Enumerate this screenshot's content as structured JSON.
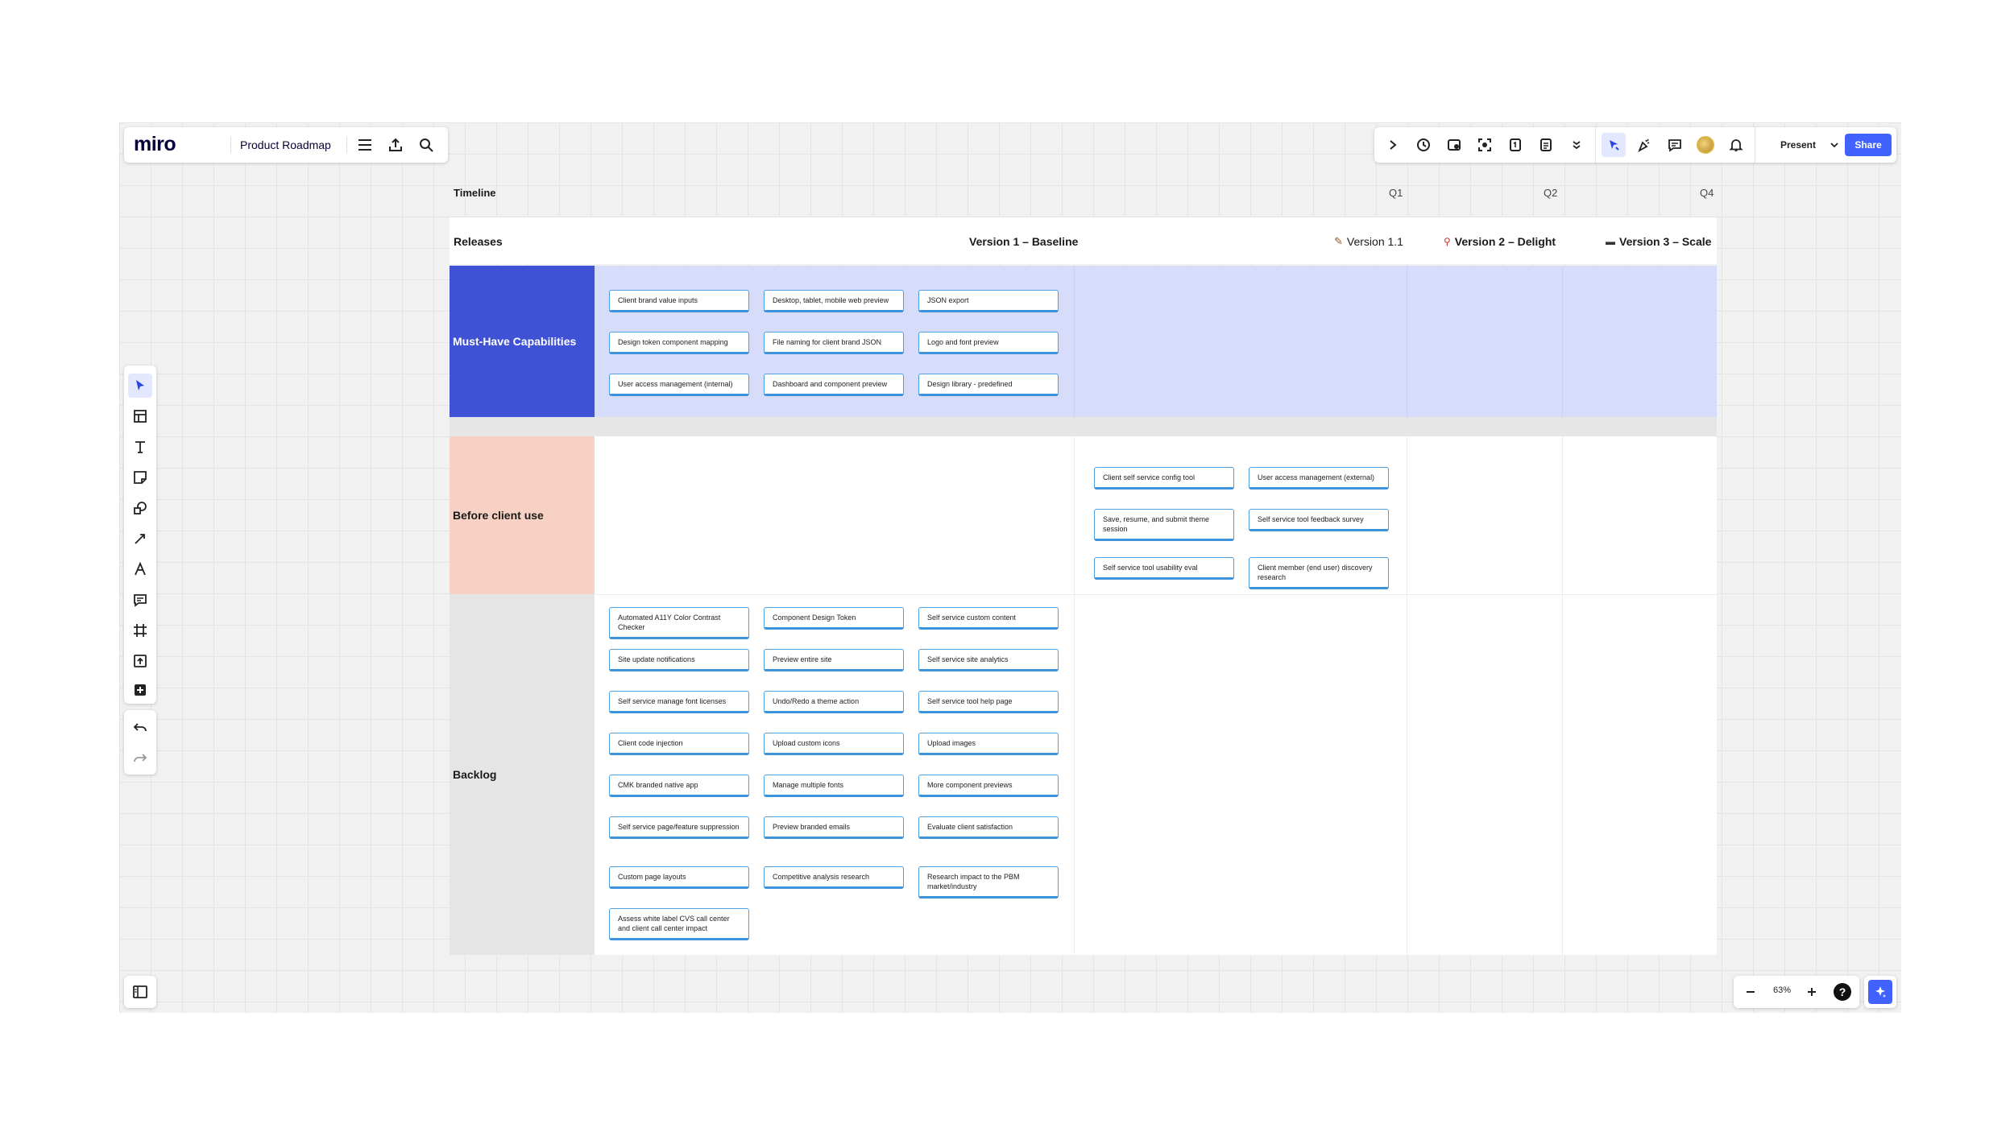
{
  "app": {
    "logo": "miro",
    "board_title": "Product Roadmap"
  },
  "toolbar_right": {
    "present_label": "Present",
    "share_label": "Share"
  },
  "zoom": {
    "level": "63%",
    "help": "?"
  },
  "board": {
    "timeline_label": "Timeline",
    "quarters": [
      "Q1",
      "Q2",
      "Q4"
    ],
    "releases_label": "Releases",
    "versions": [
      "Version 1 – Baseline",
      "Version 1.1",
      "Version 2 – Delight",
      "Version 3 – Scale"
    ],
    "rows": [
      "Must-Have Capabilities",
      "Before client use",
      "Backlog"
    ],
    "must_have_cards": [
      "Client brand value inputs",
      "Desktop, tablet, mobile web preview",
      "JSON export",
      "Design token component mapping",
      "File naming for client brand JSON",
      "Logo and font preview",
      "User access management (internal)",
      "Dashboard and component preview",
      "Design library - predefined"
    ],
    "before_cards": [
      "Client self service config tool",
      "User access management (external)",
      "Save, resume, and submit theme session",
      "Self service tool feedback survey",
      "Self service tool usability eval",
      "Client member (end user) discovery research"
    ],
    "backlog_cards": [
      "Automated A11Y Color Contrast Checker",
      "Component Design Token",
      "Self service custom content",
      "Site update notifications",
      "Preview entire site",
      "Self service site analytics",
      "Self service manage font licenses",
      "Undo/Redo a theme action",
      "Self service tool help page",
      "Client code injection",
      "Upload custom icons",
      "Upload images",
      "CMK branded native app",
      "Manage multiple fonts",
      "More component previews",
      "Self service page/feature suppression",
      "Preview branded emails",
      "Evaluate client satisfaction",
      "Custom page layouts",
      "Competitive analysis research",
      "Research impact to the PBM market/industry",
      "Assess white label CVS call center and client call center impact"
    ]
  },
  "colors": {
    "must_have_label_bg": "#3f51d4",
    "must_have_row_bg": "#d6dcfa",
    "before_label_bg": "#f7d1c4",
    "backlog_label_bg": "#e5e5e5",
    "share_button": "#4262ff",
    "card_border": "#4a9fe0"
  }
}
